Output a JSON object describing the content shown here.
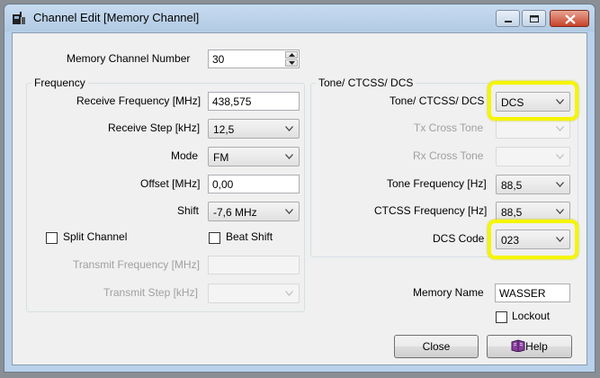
{
  "window": {
    "title": "Channel Edit [Memory Channel]"
  },
  "memory_channel": {
    "label": "Memory Channel Number",
    "value": "30"
  },
  "frequency_group": {
    "title": "Frequency",
    "receive_frequency": {
      "label": "Receive Frequency [MHz]",
      "value": "438,575"
    },
    "receive_step": {
      "label": "Receive Step [kHz]",
      "value": "12,5"
    },
    "mode": {
      "label": "Mode",
      "value": "FM"
    },
    "offset": {
      "label": "Offset [MHz]",
      "value": "0,00"
    },
    "shift": {
      "label": "Shift",
      "value": "-7,6 MHz"
    },
    "split_channel": {
      "label": "Split Channel",
      "checked": false
    },
    "beat_shift": {
      "label": "Beat Shift",
      "checked": false
    },
    "transmit_frequency": {
      "label": "Transmit Frequency [MHz]",
      "value": ""
    },
    "transmit_step": {
      "label": "Transmit Step [kHz]",
      "value": ""
    }
  },
  "tone_group": {
    "title": "Tone/ CTCSS/ DCS",
    "tone_ctcss_dcs": {
      "label": "Tone/ CTCSS/ DCS",
      "value": "DCS"
    },
    "tx_cross_tone": {
      "label": "Tx Cross Tone",
      "value": ""
    },
    "rx_cross_tone": {
      "label": "Rx Cross Tone",
      "value": ""
    },
    "tone_frequency": {
      "label": "Tone Frequency [Hz]",
      "value": "88,5"
    },
    "ctcss_frequency": {
      "label": "CTCSS Frequency [Hz]",
      "value": "88,5"
    },
    "dcs_code": {
      "label": "DCS Code",
      "value": "023"
    }
  },
  "memory_name": {
    "label": "Memory Name",
    "value": "WASSER"
  },
  "lockout": {
    "label": "Lockout",
    "checked": false
  },
  "buttons": {
    "close": "Close",
    "help": "Help"
  },
  "colors": {
    "highlight": "#f5f500",
    "title_bar": "#b9d1ea",
    "close_button": "#c7432a"
  }
}
